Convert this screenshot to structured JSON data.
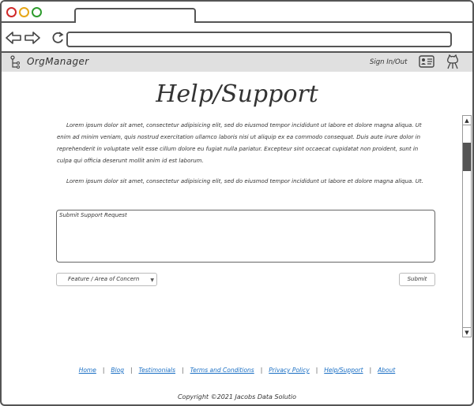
{
  "app": {
    "name": "OrgManager",
    "sign_in_label": "Sign In/Out"
  },
  "page": {
    "title": "Help/Support",
    "paragraphs": [
      "Lorem ipsum dolor sit amet, consectetur adipisicing elit, sed do eiusmod tempor incididunt ut labore et dolore magna aliqua. Ut enim ad minim veniam, quis nostrud exercitation ullamco laboris nisi ut aliquip ex ea commodo consequat. Duis aute irure dolor in reprehenderit in voluptate velit esse cillum dolore eu fugiat nulla pariatur. Excepteur sint occaecat cupidatat non proident, sunt in culpa qui officia deserunt mollit anim id est laborum.",
      "Lorem ipsum dolor sit amet, consectetur adipisicing elit, sed do eiusmod tempor incididunt ut labore et dolore magna aliqua. Ut."
    ]
  },
  "form": {
    "request_placeholder": "Submit Support Request",
    "concern_select": "Feature / Area of Concern",
    "submit_label": "Submit"
  },
  "footer": {
    "links": [
      "Home",
      "Blog",
      "Testimonials",
      "Terms and Conditions",
      "Privacy Policy",
      "Help/Support",
      "About"
    ],
    "copyright": "Copyright ©2021 Jacobs Data Solutio"
  },
  "icons": {
    "back": "arrow-left-icon",
    "forward": "arrow-right-icon",
    "reload": "reload-icon",
    "logo": "org-tree-icon",
    "profile": "id-card-icon",
    "github": "octocat-icon"
  },
  "colors": {
    "link": "#1a6fc4",
    "appbar": "#e0e0e0",
    "close_dot": "#d02a2a",
    "min_dot": "#e6a617",
    "max_dot": "#2e9c2e"
  }
}
